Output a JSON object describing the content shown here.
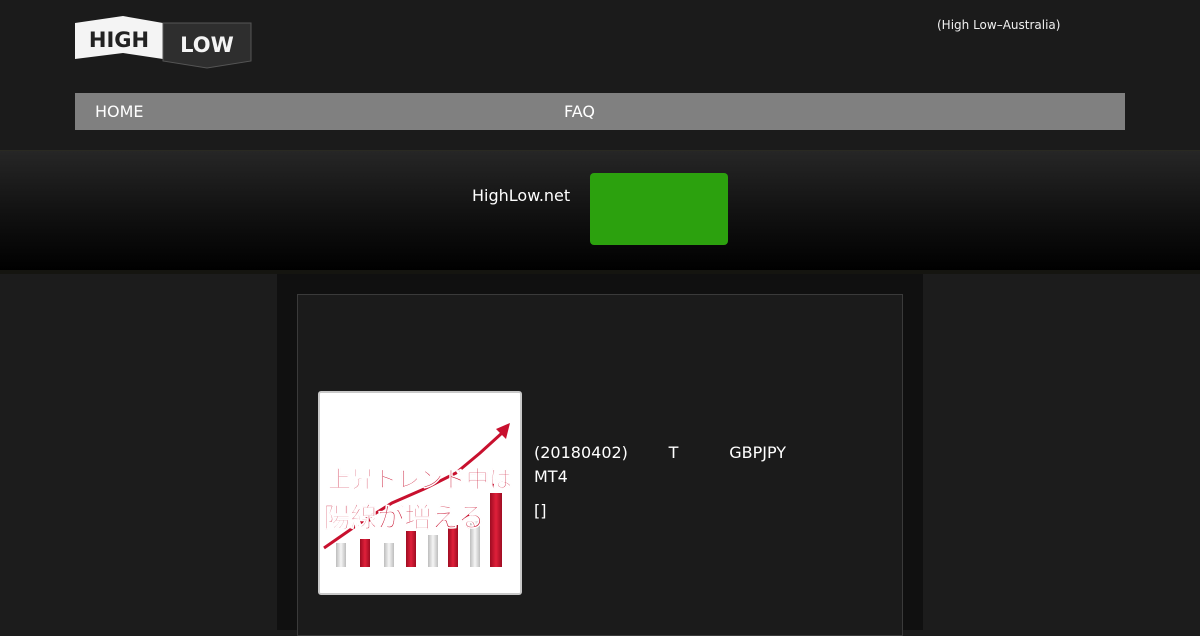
{
  "header": {
    "logo": {
      "word_high": "HIGH",
      "word_low": "LOW"
    },
    "region_note": "(High Low–Australia)"
  },
  "nav": {
    "home_label": "HOME",
    "faq_label": "FAQ"
  },
  "banner": {
    "site_label": "HighLow.net",
    "cta_color": "#2ca10e"
  },
  "article": {
    "thumbnail": {
      "line1": "上昇トレンド中は",
      "line2": "陽線が増える"
    },
    "text_line1": "(20180402)        T          GBPJPY",
    "text_line2": "MT4",
    "tag": "[]"
  },
  "colors": {
    "background": "#1c1c1c",
    "nav": "#808080",
    "accent_green": "#2ca10e",
    "thumb_red": "#c8102e"
  }
}
